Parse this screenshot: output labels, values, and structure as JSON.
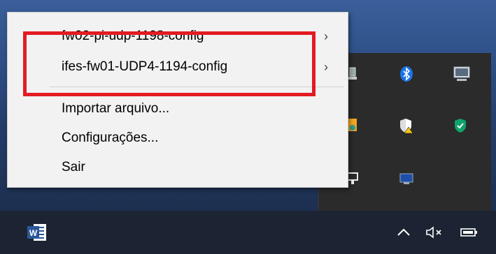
{
  "menu": {
    "items": [
      {
        "label": "fw02-pi-udp-1198-config",
        "submenu": true
      },
      {
        "label": "ifes-fw01-UDP4-1194-config",
        "submenu": true
      },
      {
        "label": "Importar arquivo...",
        "submenu": false
      },
      {
        "label": "Configurações...",
        "submenu": false
      },
      {
        "label": "Sair",
        "submenu": false
      }
    ],
    "submenu_arrow": "›"
  },
  "taskbar": {
    "app_icon": "word-icon",
    "word_letter": "W"
  },
  "colors": {
    "highlight": "#e31b23",
    "menu_bg": "#f2f2f2",
    "taskbar_bg": "#1c2433",
    "shield": "#0fa36b",
    "bluetooth": "#1a73e8"
  }
}
